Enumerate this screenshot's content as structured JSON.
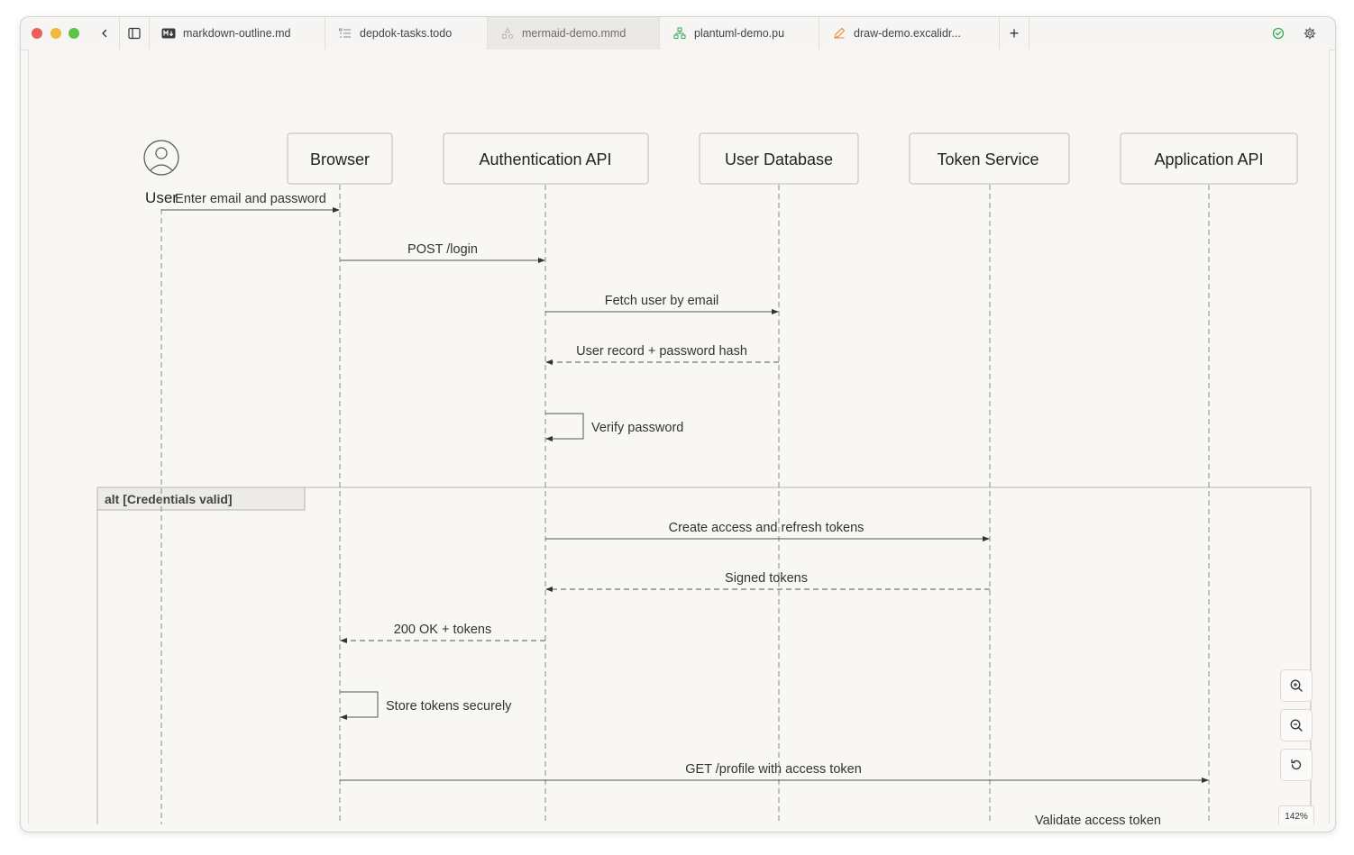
{
  "tabs": [
    {
      "label": "markdown-outline.md",
      "icon": "markdown-icon",
      "active": false
    },
    {
      "label": "depdok-tasks.todo",
      "icon": "checklist-icon",
      "active": false
    },
    {
      "label": "mermaid-demo.mmd",
      "icon": "mermaid-icon",
      "active": true
    },
    {
      "label": "plantuml-demo.pu",
      "icon": "plantuml-icon",
      "active": false
    },
    {
      "label": "draw-demo.excalidr...",
      "icon": "excalidraw-icon",
      "active": false
    }
  ],
  "toolbar": {
    "new_tab": "+"
  },
  "diagram": {
    "actor": "User",
    "participants": [
      "Browser",
      "Authentication API",
      "User Database",
      "Token Service",
      "Application API"
    ],
    "messages": [
      "Enter email and password",
      "POST /login",
      "Fetch user by email",
      "User record + password hash",
      "Verify password",
      "Create access and refresh tokens",
      "Signed tokens",
      "200 OK + tokens",
      "Store tokens securely",
      "GET /profile with access token",
      "Validate access token"
    ],
    "alt_label": "alt [Credentials valid]"
  },
  "zoom": {
    "level": "142%"
  },
  "colors": {
    "traffic_red": "#ec5f57",
    "traffic_yellow": "#f0b83c",
    "traffic_green": "#5ec34b",
    "status_ok": "#3aa757",
    "excalidraw_orange": "#e8872c"
  }
}
